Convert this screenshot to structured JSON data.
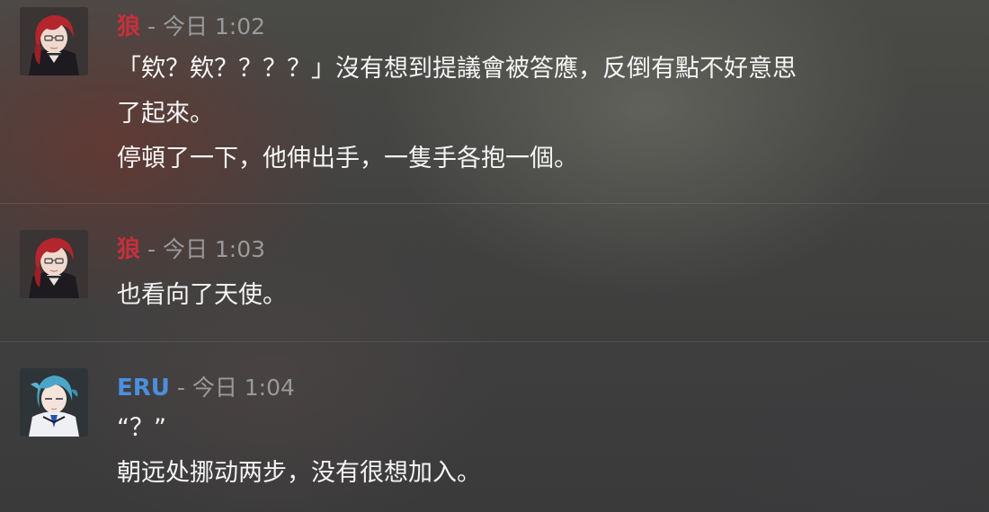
{
  "messages": [
    {
      "author": "狼",
      "author_color": "#c6303c",
      "separator": " - ",
      "time": "今日 1:02",
      "avatar_icon": "red-haired-character-avatar",
      "lines": [
        "「欸？欸？？？？」沒有想到提議會被答應，反倒有點不好意思",
        "了起來。",
        "停頓了一下，他伸出手，一隻手各抱一個。"
      ]
    },
    {
      "author": "狼",
      "author_color": "#c6303c",
      "separator": " - ",
      "time": "今日 1:03",
      "avatar_icon": "red-haired-character-avatar",
      "lines": [
        "也看向了天使。"
      ]
    },
    {
      "author": "ERU",
      "author_color": "#4b8fe0",
      "separator": " - ",
      "time": "今日 1:04",
      "avatar_icon": "blue-haired-character-avatar",
      "lines": [
        "“？”",
        "朝远处挪动两步，没有很想加入。"
      ]
    }
  ]
}
